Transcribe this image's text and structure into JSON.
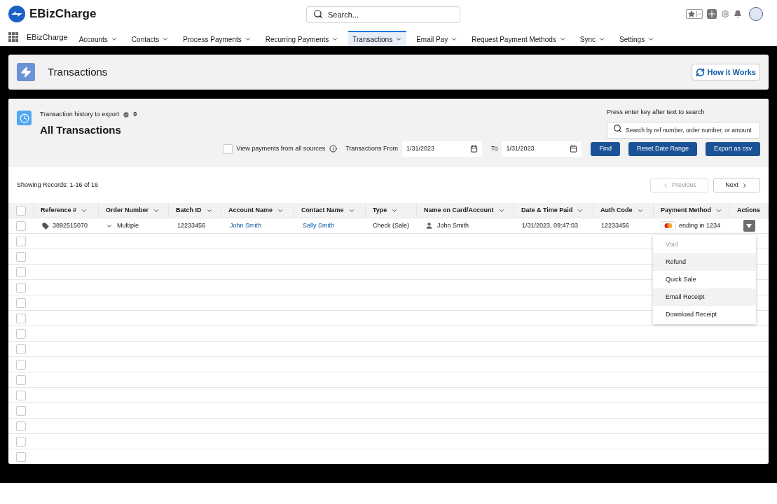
{
  "header": {
    "brand": "EBizCharge",
    "search": {
      "placeholder": "Search..."
    }
  },
  "nav": {
    "app_name": "EBizCharge",
    "items": [
      {
        "label": "Accounts",
        "selected": false
      },
      {
        "label": "Contacts",
        "selected": false
      },
      {
        "label": "Process Payments",
        "selected": false
      },
      {
        "label": "Recurring Payments",
        "selected": false
      },
      {
        "label": "Transactions",
        "selected": true
      },
      {
        "label": "Email Pay",
        "selected": false
      },
      {
        "label": "Request Payment Methods",
        "selected": false
      },
      {
        "label": "Sync",
        "selected": false
      },
      {
        "label": "Settings",
        "selected": false
      }
    ]
  },
  "page_header": {
    "title": "Transactions",
    "help_button": "How it Works"
  },
  "list_header": {
    "export_label": "Transaction history to export",
    "export_count": "0",
    "title": "All Transactions",
    "search_hint": "Press enter key after text to search",
    "search": {
      "placeholder": "Search by ref number, order number, or amount"
    },
    "all_sources": {
      "label": "View payments from all sources",
      "checked": false
    },
    "from_label": "Transactions From",
    "from_value": "1/31/2023",
    "to_label": "To",
    "to_value": "1/31/2023",
    "buttons": [
      "Find",
      "Reset Date Range",
      "Export as csv"
    ]
  },
  "pagination": {
    "summary": "Showing Records: 1-16 of 16",
    "previous": {
      "label": "Previous",
      "disabled": true
    },
    "next": {
      "label": "Next",
      "disabled": false
    }
  },
  "table": {
    "columns": [
      "Reference #",
      "Order Number",
      "Batch ID",
      "Account Name",
      "Contact Name",
      "Type",
      "Name on Card/Account",
      "Date & Time Paid",
      "Auth Code",
      "Payment Method",
      "Actions"
    ],
    "header_checked": false,
    "rows": [
      {
        "checked": false,
        "reference": "3892515070",
        "order": "Multiple",
        "batch": "12233456",
        "account": "John Smith",
        "contact": "Sally Smith",
        "type": "Check (Sale)",
        "name_on_card": "John Smith",
        "date": "1/31/2023, 09:47:03",
        "auth": "12233456",
        "payment": "ending in 1234"
      },
      {
        "checked": false
      },
      {
        "checked": false
      },
      {
        "checked": false
      },
      {
        "checked": false
      },
      {
        "checked": false
      },
      {
        "checked": false
      },
      {
        "checked": false
      },
      {
        "checked": false
      },
      {
        "checked": false
      },
      {
        "checked": false
      },
      {
        "checked": false
      },
      {
        "checked": false
      },
      {
        "checked": false
      },
      {
        "checked": false
      },
      {
        "checked": false
      }
    ]
  },
  "actions_menu": [
    {
      "label": "Void",
      "disabled": true,
      "highlighted": false
    },
    {
      "label": "Refund",
      "disabled": false,
      "highlighted": true
    },
    {
      "label": "Quick Sale",
      "disabled": false,
      "highlighted": false
    },
    {
      "label": "Email Receipt",
      "disabled": false,
      "highlighted": true
    },
    {
      "label": "Download Receipt",
      "disabled": false,
      "highlighted": false
    }
  ]
}
